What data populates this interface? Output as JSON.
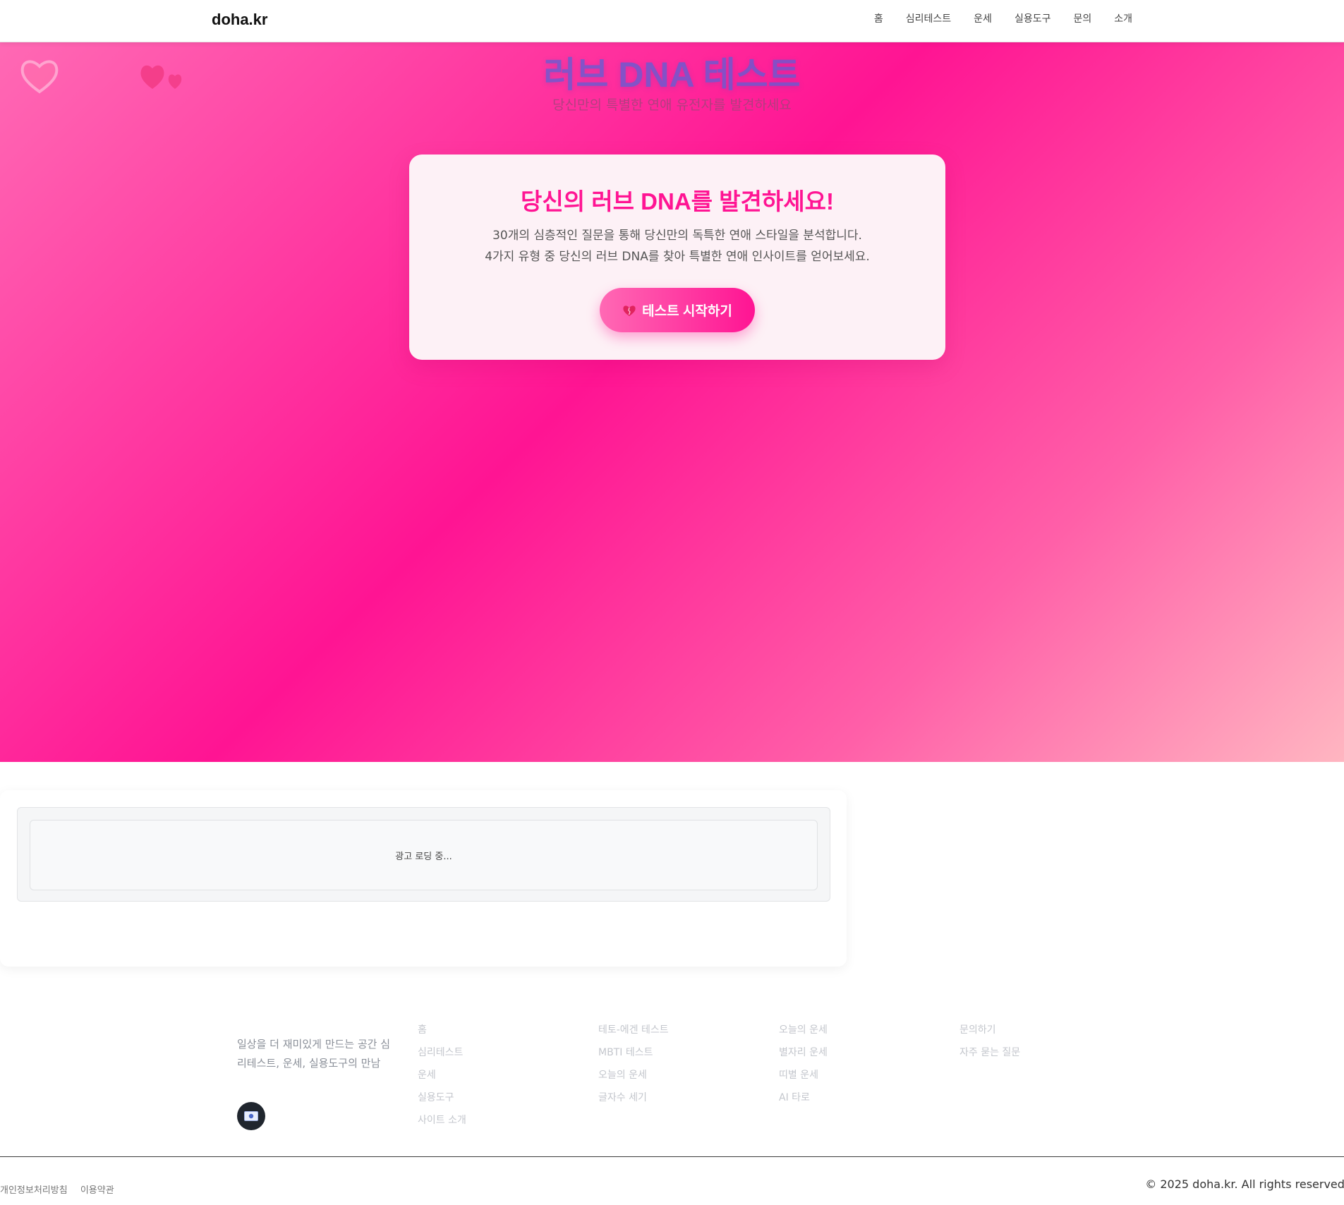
{
  "header": {
    "logo": "doha.kr",
    "nav": [
      "홈",
      "심리테스트",
      "운세",
      "실용도구",
      "문의",
      "소개"
    ]
  },
  "hero": {
    "title": "러브 DNA 테스트",
    "subtitle": "당신만의 특별한 연애 유전자를 발견하세요"
  },
  "intro_card": {
    "heading": "당신의 러브 DNA를 발견하세요!",
    "line1": "30개의 심층적인 질문을 통해 당신만의 독특한 연애 스타일을 분석합니다.",
    "line2": "4가지 유형 중 당신의 러브 DNA를 찾아 특별한 연애 인사이트를 얻어보세요.",
    "start_button": "테스트 시작하기",
    "start_icon": "heart-icon"
  },
  "ad": {
    "loading_text": "광고 로딩 중..."
  },
  "footer": {
    "description": "일상을 더 재미있게 만드는 공간 심리테스트, 운세, 실용도구의 만남",
    "columns": [
      [
        "홈",
        "심리테스트",
        "운세",
        "실용도구",
        "사이트 소개"
      ],
      [
        "테토-에겐 테스트",
        "MBTI 테스트",
        "오늘의 운세",
        "글자수 세기"
      ],
      [
        "오늘의 운세",
        "별자리 운세",
        "띠별 운세",
        "AI 타로"
      ],
      [
        "문의하기",
        "자주 묻는 질문"
      ]
    ],
    "legal": [
      "개인정보처리방침",
      "이용약관"
    ],
    "copyright": "© 2025 doha.kr. All rights reserved."
  },
  "colors": {
    "accent": "#ff1493",
    "accent_light": "#ff69b4"
  }
}
